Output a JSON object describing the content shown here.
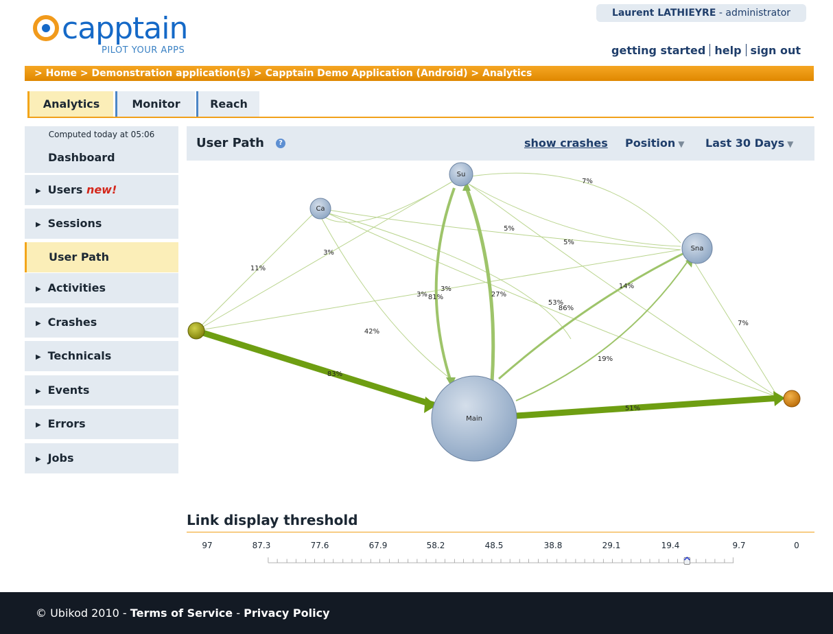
{
  "brand": {
    "name": "capptain",
    "tagline": "PILOT YOUR APPS"
  },
  "user": {
    "name": "Laurent LATHIEYRE",
    "role": "- administrator"
  },
  "top_links": [
    "getting started",
    "help",
    "sign out"
  ],
  "breadcrumb": "> Home > Demonstration application(s) > Capptain Demo Application (Android) > Analytics",
  "tabs": [
    "Analytics",
    "Monitor",
    "Reach"
  ],
  "sidebar": {
    "computed": "Computed today at 05:06",
    "items": [
      {
        "label": "Dashboard"
      },
      {
        "label": "Users",
        "badge": "new!"
      },
      {
        "label": "Sessions"
      },
      {
        "label": "User Path"
      },
      {
        "label": "Activities"
      },
      {
        "label": "Crashes"
      },
      {
        "label": "Technicals"
      },
      {
        "label": "Events"
      },
      {
        "label": "Errors"
      },
      {
        "label": "Jobs"
      }
    ],
    "active": "User Path"
  },
  "main": {
    "title": "User Path",
    "show_crashes": "show crashes",
    "position": "Position",
    "range": "Last 30 Days"
  },
  "graph": {
    "nodes": [
      "Su",
      "Ca",
      "Sna",
      "Main"
    ],
    "edge_labels": [
      "7%",
      "5%",
      "5%",
      "3%",
      "11%",
      "3%",
      "3%",
      "81%",
      "27%",
      "53%",
      "86%",
      "14%",
      "42%",
      "7%",
      "19%",
      "83%",
      "51%"
    ]
  },
  "threshold": {
    "title": "Link display threshold",
    "ticks": [
      "97",
      "87.3",
      "77.6",
      "67.9",
      "58.2",
      "48.5",
      "38.8",
      "29.1",
      "19.4",
      "9.7",
      "0"
    ],
    "value": 9.7
  },
  "footer": {
    "copyright": "© Ubikod 2010 -",
    "terms": "Terms of Service",
    "dash": "-",
    "privacy": "Privacy Policy"
  },
  "colors": {
    "orange": "#f1a019",
    "panel": "#e3eaf1",
    "active": "#fbeeb8",
    "link": "#1f3e6b",
    "edge": "#7aa31f"
  }
}
